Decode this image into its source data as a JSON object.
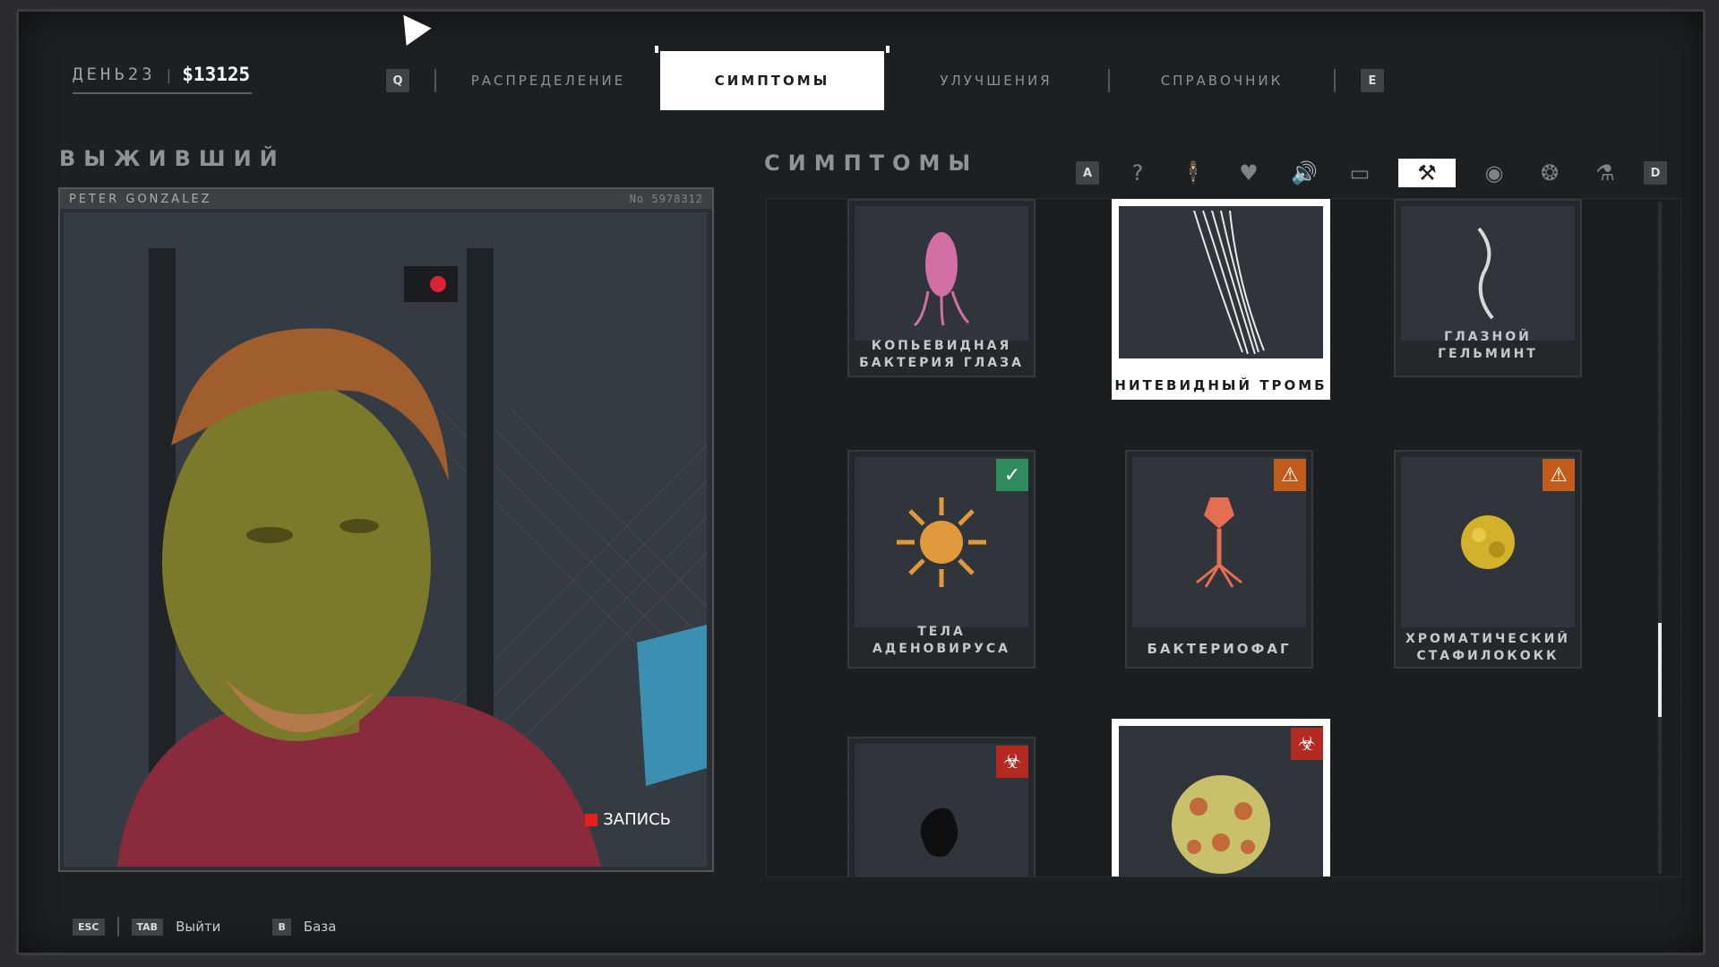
{
  "hud": {
    "day_label": "ДЕНЬ23",
    "separator": "|",
    "money": "$13125"
  },
  "tabs": {
    "prev_key": "Q",
    "next_key": "E",
    "items": [
      {
        "label": "РАСПРЕДЕЛЕНИЕ"
      },
      {
        "label": "СИМПТОМЫ"
      },
      {
        "label": "УЛУЧШЕНИЯ"
      },
      {
        "label": "СПРАВОЧНИК"
      }
    ]
  },
  "survivor": {
    "section_title": "ВЫЖИВШИЙ",
    "name": "PETER GONZALEZ",
    "id": "No 5978312",
    "rec_label": "ЗАПИСЬ"
  },
  "symptoms": {
    "section_title": "СИМПТОМЫ",
    "filter_left_key": "A",
    "filter_right_key": "D",
    "filters": [
      {
        "icon": "question-icon",
        "glyph": "?"
      },
      {
        "icon": "body-icon",
        "glyph": "🕴"
      },
      {
        "icon": "heart-icon",
        "glyph": "♥"
      },
      {
        "icon": "sound-icon",
        "glyph": "🔊"
      },
      {
        "icon": "briefcase-icon",
        "glyph": "▭"
      },
      {
        "icon": "tool-icon",
        "glyph": "⚒"
      },
      {
        "icon": "eye-icon",
        "glyph": "◉"
      },
      {
        "icon": "brain-icon",
        "glyph": "❂"
      },
      {
        "icon": "flask-icon",
        "glyph": "⚗"
      }
    ],
    "cards": [
      {
        "label": "КОПЬЕВИДНАЯ БАКТЕРИЯ ГЛАЗА",
        "badge": ""
      },
      {
        "label": "НИТЕВИДНЫЙ ТРОМБ",
        "badge": ""
      },
      {
        "label": "ГЛАЗНОЙ ГЕЛЬМИНТ",
        "badge": ""
      },
      {
        "label": "ТЕЛА АДЕНОВИРУСА",
        "badge": "shield-check-icon"
      },
      {
        "label": "БАКТЕРИОФАГ",
        "badge": "warning-icon"
      },
      {
        "label": "ХРОМАТИЧЕСКИЙ СТАФИЛОКОКК",
        "badge": "warning-icon"
      },
      {
        "label": "",
        "badge": "biohazard-icon"
      },
      {
        "label": "",
        "badge": "biohazard-icon"
      }
    ]
  },
  "footer": {
    "esc_key": "ESC",
    "tab_key": "TAB",
    "exit_label": "Выйти",
    "b_key": "B",
    "base_label": "База"
  },
  "colors": {
    "accent_green": "#2f8a5d",
    "warning_orange": "#c15c1c",
    "biohazard_red": "#b22a22",
    "record_red": "#e0221b"
  }
}
